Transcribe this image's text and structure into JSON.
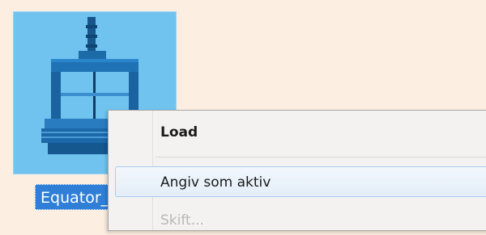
{
  "file_item": {
    "name": "Equator_",
    "thumbnail_icon": "equator-gauge-icon"
  },
  "context_menu": {
    "items": [
      {
        "label": "Load"
      },
      {
        "label": "Angiv som aktiv"
      },
      {
        "label": "Skift..."
      }
    ]
  },
  "colors": {
    "background": "#fcefe2",
    "thumbnail": "#6fc3ee",
    "selection": "#2f7fd6",
    "menu_bg": "#f3f2f0",
    "menu_hover": "#e4eef8"
  }
}
